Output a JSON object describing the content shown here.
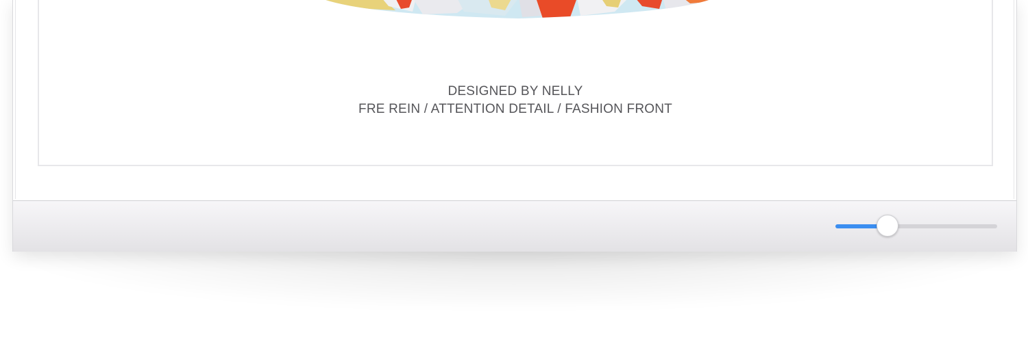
{
  "artwork": {
    "caption_line1": "DESIGNED BY NELLY",
    "caption_line2": "FRE REIN / ATTENTION DETAIL / FASHION FRONT"
  },
  "toolbar": {
    "zoom_slider": {
      "value_fraction": 0.32,
      "accent_color": "#3b8ef0"
    }
  }
}
